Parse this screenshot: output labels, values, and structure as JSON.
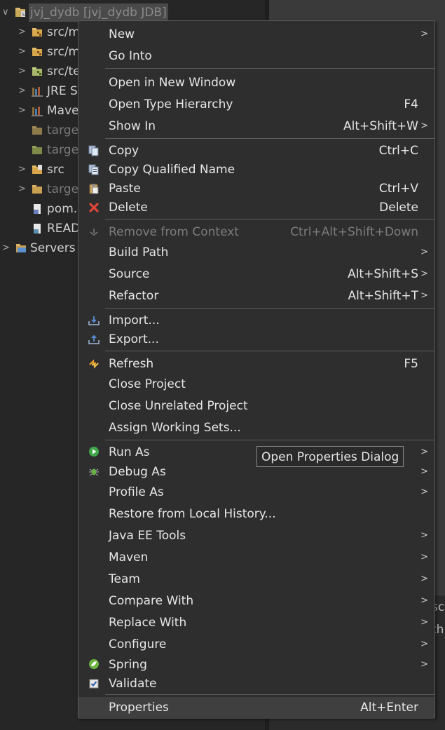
{
  "tree": {
    "project_label": "jvj_dydb [jvj_dydb JDB]",
    "items": [
      {
        "label": "src/m",
        "icon": "java-package-folder-icon"
      },
      {
        "label": "src/m",
        "icon": "java-package-folder-icon"
      },
      {
        "label": "src/te",
        "icon": "java-package-folder-icon"
      },
      {
        "label": "JRE Sy",
        "icon": "library-icon"
      },
      {
        "label": "Mave",
        "icon": "library-icon"
      },
      {
        "label": "target",
        "icon": "folder-icon"
      },
      {
        "label": "target",
        "icon": "folder-icon"
      },
      {
        "label": "src",
        "icon": "source-folder-icon"
      },
      {
        "label": "target",
        "icon": "folder-icon"
      },
      {
        "label": "pom.",
        "icon": "xml-file-icon"
      },
      {
        "label": "READ",
        "icon": "file-icon"
      },
      {
        "label": "Servers",
        "icon": "folder-icon"
      }
    ]
  },
  "right_panel": {
    "line1": "sc",
    "line2": "th"
  },
  "menu": {
    "new": "New",
    "go_into": "Go Into",
    "open_new_window": "Open in New Window",
    "open_type_hierarchy": "Open Type Hierarchy",
    "open_type_hierarchy_shortcut": "F4",
    "show_in": "Show In",
    "show_in_shortcut": "Alt+Shift+W",
    "copy": "Copy",
    "copy_shortcut": "Ctrl+C",
    "copy_qualified": "Copy Qualified Name",
    "paste": "Paste",
    "paste_shortcut": "Ctrl+V",
    "delete": "Delete",
    "delete_shortcut": "Delete",
    "remove_context": "Remove from Context",
    "remove_context_shortcut": "Ctrl+Alt+Shift+Down",
    "build_path": "Build Path",
    "source": "Source",
    "source_shortcut": "Alt+Shift+S",
    "refactor": "Refactor",
    "refactor_shortcut": "Alt+Shift+T",
    "import": "Import...",
    "export": "Export...",
    "refresh": "Refresh",
    "refresh_shortcut": "F5",
    "close_project": "Close Project",
    "close_unrelated": "Close Unrelated Project",
    "assign_working_sets": "Assign Working Sets...",
    "run_as": "Run As",
    "debug_as": "Debug As",
    "profile_as": "Profile As",
    "restore_history": "Restore from Local History...",
    "java_ee_tools": "Java EE Tools",
    "maven": "Maven",
    "team": "Team",
    "compare_with": "Compare With",
    "replace_with": "Replace With",
    "configure": "Configure",
    "spring": "Spring",
    "validate": "Validate",
    "properties": "Properties",
    "properties_shortcut": "Alt+Enter"
  },
  "tooltip": {
    "text": "Open Properties Dialog"
  }
}
